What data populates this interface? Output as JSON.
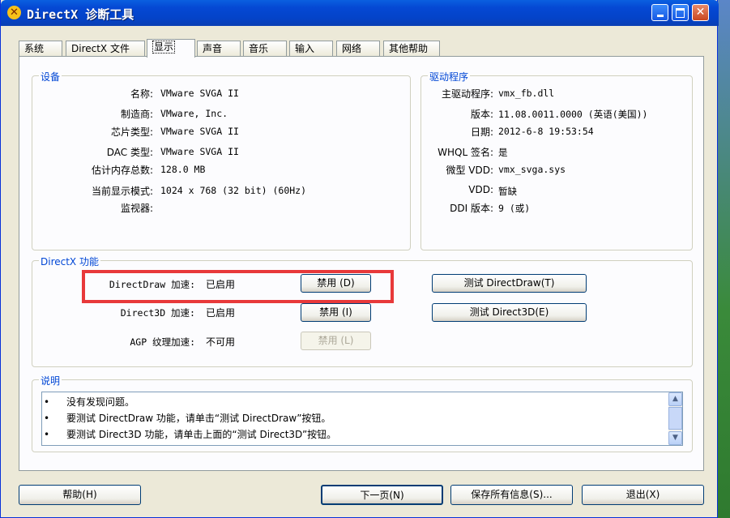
{
  "window": {
    "title": "DirectX 诊断工具",
    "icon": "directx-icon",
    "close_glyph": "✕"
  },
  "tabs": [
    {
      "label": "系统"
    },
    {
      "label": "DirectX 文件"
    },
    {
      "label": "显示"
    },
    {
      "label": "声音"
    },
    {
      "label": "音乐"
    },
    {
      "label": "输入"
    },
    {
      "label": "网络"
    },
    {
      "label": "其他帮助"
    }
  ],
  "device": {
    "group_label": "设备",
    "rows": [
      {
        "label": "名称:",
        "value": "VMware SVGA II"
      },
      {
        "label": "制造商:",
        "value": "VMware, Inc."
      },
      {
        "label": "芯片类型:",
        "value": "VMware SVGA II"
      },
      {
        "label": "DAC 类型:",
        "value": "VMware SVGA II"
      },
      {
        "label": "估计内存总数:",
        "value": "128.0 MB"
      },
      {
        "label": "当前显示模式:",
        "value": "1024 x 768 (32 bit) (60Hz)"
      },
      {
        "label": "监视器:",
        "value": ""
      }
    ]
  },
  "driver": {
    "group_label": "驱动程序",
    "rows": [
      {
        "label": "主驱动程序:",
        "value": "vmx_fb.dll"
      },
      {
        "label": "版本:",
        "value": "11.08.0011.0000 (英语(美国))"
      },
      {
        "label": "日期:",
        "value": "2012-6-8 19:53:54"
      },
      {
        "label": "WHQL 签名:",
        "value": "是"
      },
      {
        "label": "微型 VDD:",
        "value": "vmx_svga.sys"
      },
      {
        "label": "VDD:",
        "value": "暂缺"
      },
      {
        "label": "DDI 版本:",
        "value": "9 (或)"
      }
    ]
  },
  "features": {
    "group_label": "DirectX 功能",
    "rows": [
      {
        "label": "DirectDraw 加速:",
        "status": "已启用",
        "disable_label": "禁用 (D)",
        "test_label": "测试 DirectDraw(T)"
      },
      {
        "label": "Direct3D 加速:",
        "status": "已启用",
        "disable_label": "禁用 (I)",
        "test_label": "测试 Direct3D(E)"
      },
      {
        "label": "AGP 纹理加速:",
        "status": "不可用",
        "disable_label": "禁用 (L)"
      }
    ]
  },
  "notes": {
    "group_label": "说明",
    "bullet": "•",
    "lines": [
      "没有发现问题。",
      "要测试 DirectDraw 功能，请单击“测试 DirectDraw”按钮。",
      "要测试 Direct3D 功能，请单击上面的“测试 Direct3D”按钮。"
    ]
  },
  "footer": {
    "help_label": "帮助(H)",
    "next_label": "下一页(N)",
    "save_label": "保存所有信息(S)...",
    "exit_label": "退出(X)"
  }
}
